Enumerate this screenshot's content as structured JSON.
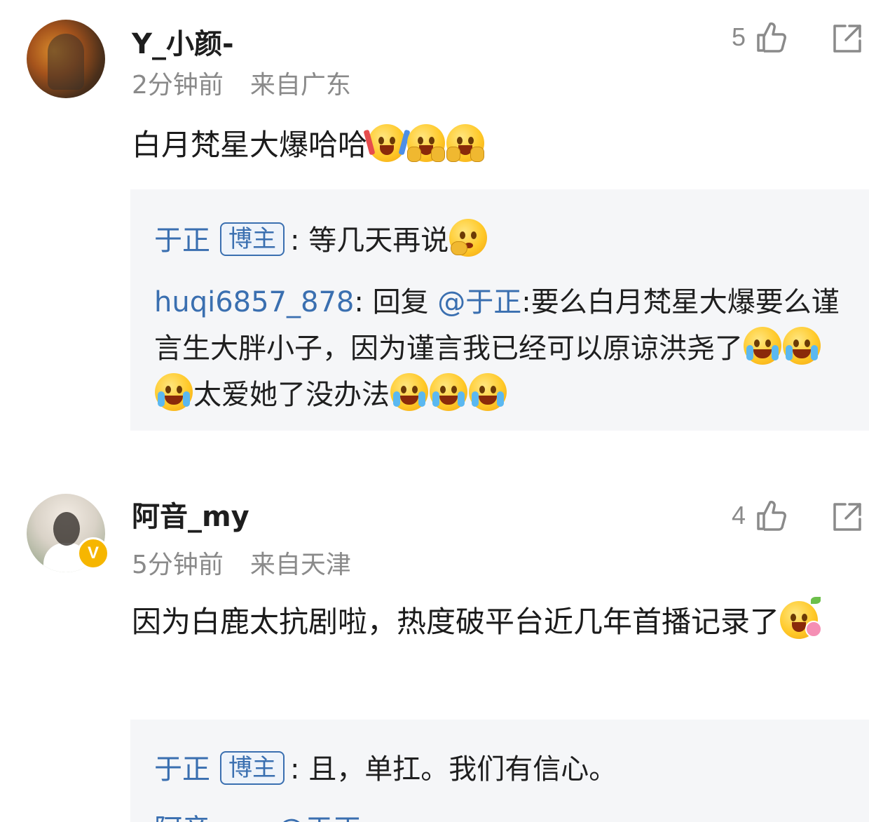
{
  "comments": [
    {
      "username": "Y_小颜-",
      "time": "2分钟前",
      "location": "来自广东",
      "likes": "5",
      "text": "白月梵星大爆哈哈",
      "replies": [
        {
          "author": "于正",
          "tag": "博主",
          "separator": ":",
          "text": "等几天再说"
        },
        {
          "author": "huqi6857_878",
          "separator": ":",
          "prefix": "回复",
          "mention": "@于正",
          "text_before": ":要么白月梵星大爆要么谨言生大胖小子，因为谨言我已经可以原谅洪尧了",
          "text_after": "太爱她了没办法"
        }
      ]
    },
    {
      "username": "阿音_my",
      "time": "5分钟前",
      "location": "来自天津",
      "likes": "4",
      "verified": "V",
      "text": "因为白鹿太抗剧啦，热度破平台近几年首播记录了",
      "replies": [
        {
          "author": "于正",
          "tag": "博主",
          "separator": ":",
          "text": "且，单扛。我们有信心。"
        },
        {
          "author": "阿音_my",
          "mention": "@于正"
        }
      ]
    }
  ],
  "icons": {
    "like": "thumbs-up-icon",
    "share": "share-icon"
  },
  "colors": {
    "link": "#3a6fb0",
    "meta": "#8a8a8a",
    "reply_bg": "#f5f6f8",
    "verified": "#f6b600"
  }
}
